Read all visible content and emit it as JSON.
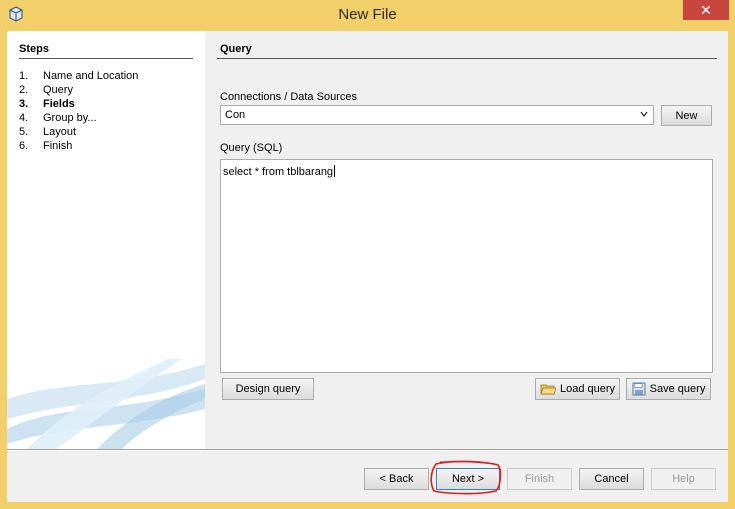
{
  "window": {
    "title": "New File",
    "close_symbol": "✕"
  },
  "steps": {
    "title": "Steps",
    "items": [
      {
        "num": "1.",
        "label": "Name and Location"
      },
      {
        "num": "2.",
        "label": "Query"
      },
      {
        "num": "3.",
        "label": "Fields"
      },
      {
        "num": "4.",
        "label": "Group by..."
      },
      {
        "num": "5.",
        "label": "Layout"
      },
      {
        "num": "6.",
        "label": "Finish"
      }
    ],
    "current_index": 2
  },
  "panel": {
    "title": "Query",
    "connections_label": "Connections / Data Sources",
    "connection_value": "Con",
    "new_button": "New",
    "query_label": "Query (SQL)",
    "query_text": "select * from tblbarang",
    "design_query_button": "Design query",
    "load_query_button": "Load query",
    "save_query_button": "Save query"
  },
  "footer": {
    "back": "< Back",
    "next": "Next >",
    "finish": "Finish",
    "cancel": "Cancel",
    "help": "Help"
  },
  "icons": {
    "app": "cube-icon",
    "load": "folder-open-icon",
    "save": "save-disk-icon",
    "dropdown": "chevron-down-icon"
  },
  "colors": {
    "titlebar": "#f2cf68",
    "close": "#c7463d",
    "annotation": "#e01b1b"
  }
}
